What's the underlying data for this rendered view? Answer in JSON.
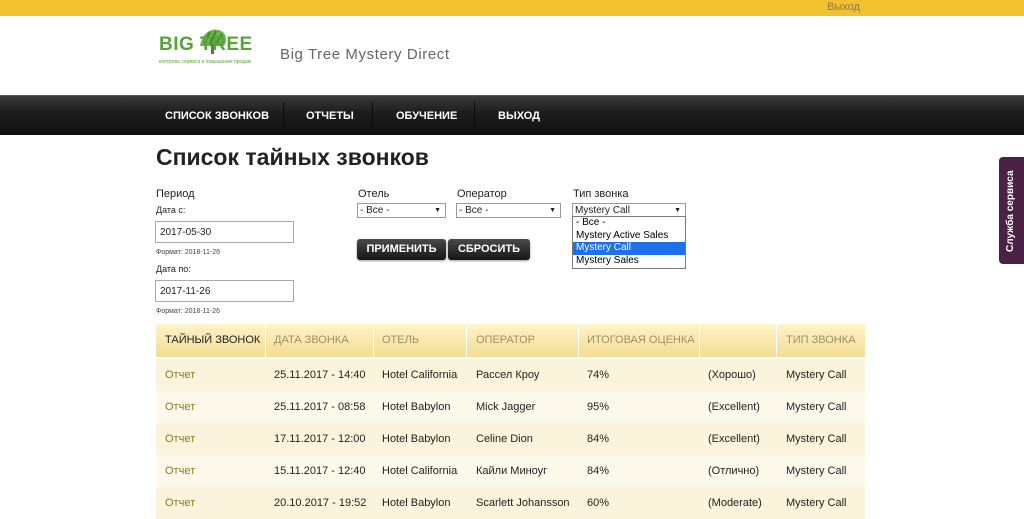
{
  "topbar": {
    "logout": "Выход"
  },
  "logo": {
    "text": "BIG TREE",
    "tagline": "контроль сервиса и повышение продаж",
    "color": "#5aa33a"
  },
  "site_title": "Big Tree Mystery Direct",
  "nav": {
    "items": [
      "СПИСОК ЗВОНКОВ",
      "ОТЧЕТЫ",
      "ОБУЧЕНИЕ",
      "ВЫХОД"
    ]
  },
  "page_title": "Список тайных звонков",
  "filters": {
    "period_label": "Период",
    "date_from_label": "Дата с:",
    "date_from_value": "2017-05-30",
    "date_from_hint": "Формат: 2018-11-26",
    "date_to_label": "Дата по:",
    "date_to_value": "2017-11-26",
    "date_to_hint": "Формат: 2018-11-26",
    "hotel_label": "Отель",
    "hotel_value": "- Все -",
    "operator_label": "Оператор",
    "operator_value": "- Все -",
    "call_type_label": "Тип звонка",
    "call_type_value": "Mystery Call",
    "call_type_options": [
      "- Все -",
      "Mystery Active Sales",
      "Mystery Call",
      "Mystery Sales"
    ],
    "call_type_selected_index": 2,
    "apply_label": "ПРИМЕНИТЬ",
    "reset_label": "СБРОСИТЬ"
  },
  "table": {
    "headers": [
      "ТАЙНЫЙ ЗВОНОК",
      "ДАТА ЗВОНКА",
      "ОТЕЛЬ",
      "ОПЕРАТОР",
      "ИТОГОВАЯ ОЦЕНКА",
      "",
      "ТИП ЗВОНКА"
    ],
    "rows": [
      [
        "Отчет",
        "25.11.2017 - 14:40",
        "Hotel California",
        "Рассел Кроу",
        "74%",
        "(Хорошо)",
        "Mystery Call"
      ],
      [
        "Отчет",
        "25.11.2017 - 08:58",
        "Hotel Babylon",
        "Mick Jagger",
        "95%",
        "(Excellent)",
        "Mystery Call"
      ],
      [
        "Отчет",
        "17.11.2017 - 12:00",
        "Hotel Babylon",
        "Celine Dion",
        "84%",
        "(Excellent)",
        "Mystery Call"
      ],
      [
        "Отчет",
        "15.11.2017 - 12:40",
        "Hotel California",
        "Кайли Миноуг",
        "84%",
        "(Отлично)",
        "Mystery Call"
      ],
      [
        "Отчет",
        "20.10.2017 - 19:52",
        "Hotel Babylon",
        "Scarlett Johansson",
        "60%",
        "(Moderate)",
        "Mystery Call"
      ]
    ]
  },
  "service_tab": "Служба сервиса"
}
